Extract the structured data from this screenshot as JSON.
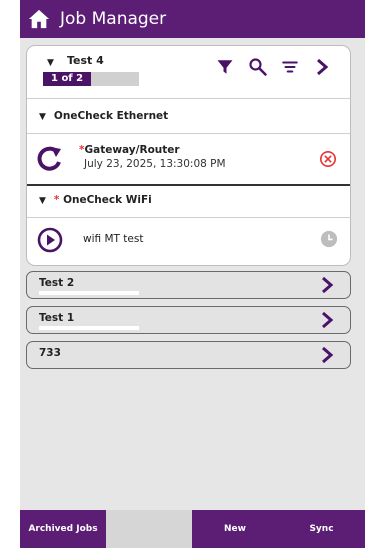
{
  "app": {
    "title": "Job Manager"
  },
  "job": {
    "name": "Test 4",
    "pager": "1 of 2",
    "pager_fill_fraction": 0.5,
    "sections": [
      {
        "title": "OneCheck Ethernet",
        "required": false,
        "tests": [
          {
            "required_mark": "*",
            "name": "Gateway/Router",
            "timestamp": "July 23, 2025, 13:30:08 PM",
            "status_icon": "failed-circle-x-icon",
            "action_icon": "retry-arrow-icon"
          }
        ]
      },
      {
        "title": "OneCheck WiFi",
        "required": true,
        "required_mark": "*",
        "tests": [
          {
            "name": "wifi MT test",
            "status_icon": "pending-clock-icon",
            "action_icon": "play-circle-icon"
          }
        ]
      }
    ]
  },
  "jobs": [
    {
      "name": "Test 2"
    },
    {
      "name": "Test 1"
    },
    {
      "name": "733"
    }
  ],
  "bottom_nav": [
    {
      "label": "Archived Jobs"
    },
    {
      "label": ""
    },
    {
      "label": "New"
    },
    {
      "label": "Sync"
    }
  ],
  "colors": {
    "primary": "#5b1e74",
    "accent_red": "#e33535",
    "background": "#e7e6e7"
  }
}
